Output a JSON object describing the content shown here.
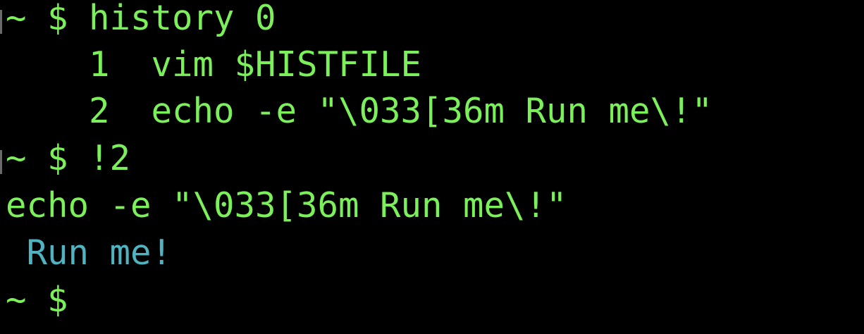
{
  "terminal": {
    "lines": [
      {
        "text": "~ $ history 0"
      },
      {
        "text": "    1  vim $HISTFILE"
      },
      {
        "text": "    2  echo -e \"\\033[36m Run me\\!\""
      },
      {
        "text": "~ $ !2"
      },
      {
        "text": "echo -e \"\\033[36m Run me\\!\""
      },
      {
        "text": " Run me!"
      },
      {
        "text": "~ $ "
      }
    ],
    "colors": {
      "background": "#000000",
      "prompt_text": "#7CF05A",
      "ansi_cyan_output": "#4FB3C1",
      "mark_indicator": "#6a6a6a"
    }
  }
}
